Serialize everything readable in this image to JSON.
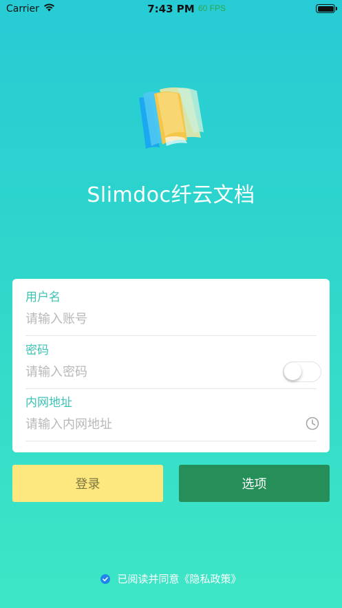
{
  "status_bar": {
    "carrier": "Carrier",
    "time": "7:43 PM",
    "fps": "60 FPS"
  },
  "app": {
    "title": "Slimdoc纤云文档"
  },
  "form": {
    "username": {
      "label": "用户名",
      "placeholder": "请输入账号",
      "value": ""
    },
    "password": {
      "label": "密码",
      "placeholder": "请输入密码",
      "value": "",
      "show_password": false
    },
    "intranet": {
      "label": "内网地址",
      "placeholder": "请输入内网地址",
      "value": ""
    }
  },
  "buttons": {
    "login": "登录",
    "options": "选项"
  },
  "agreement": {
    "checked": true,
    "text": "已阅读并同意《隐私政策》"
  },
  "colors": {
    "bg_top": "#27cbd5",
    "bg_bottom": "#3de6c5",
    "label": "#3cc3b4",
    "login_bg": "#fde77f",
    "options_bg": "#268e58",
    "check": "#1f86ea"
  },
  "icons": [
    "wifi-icon",
    "battery-icon",
    "app-logo-icon",
    "clock-icon",
    "checkmark-icon"
  ]
}
